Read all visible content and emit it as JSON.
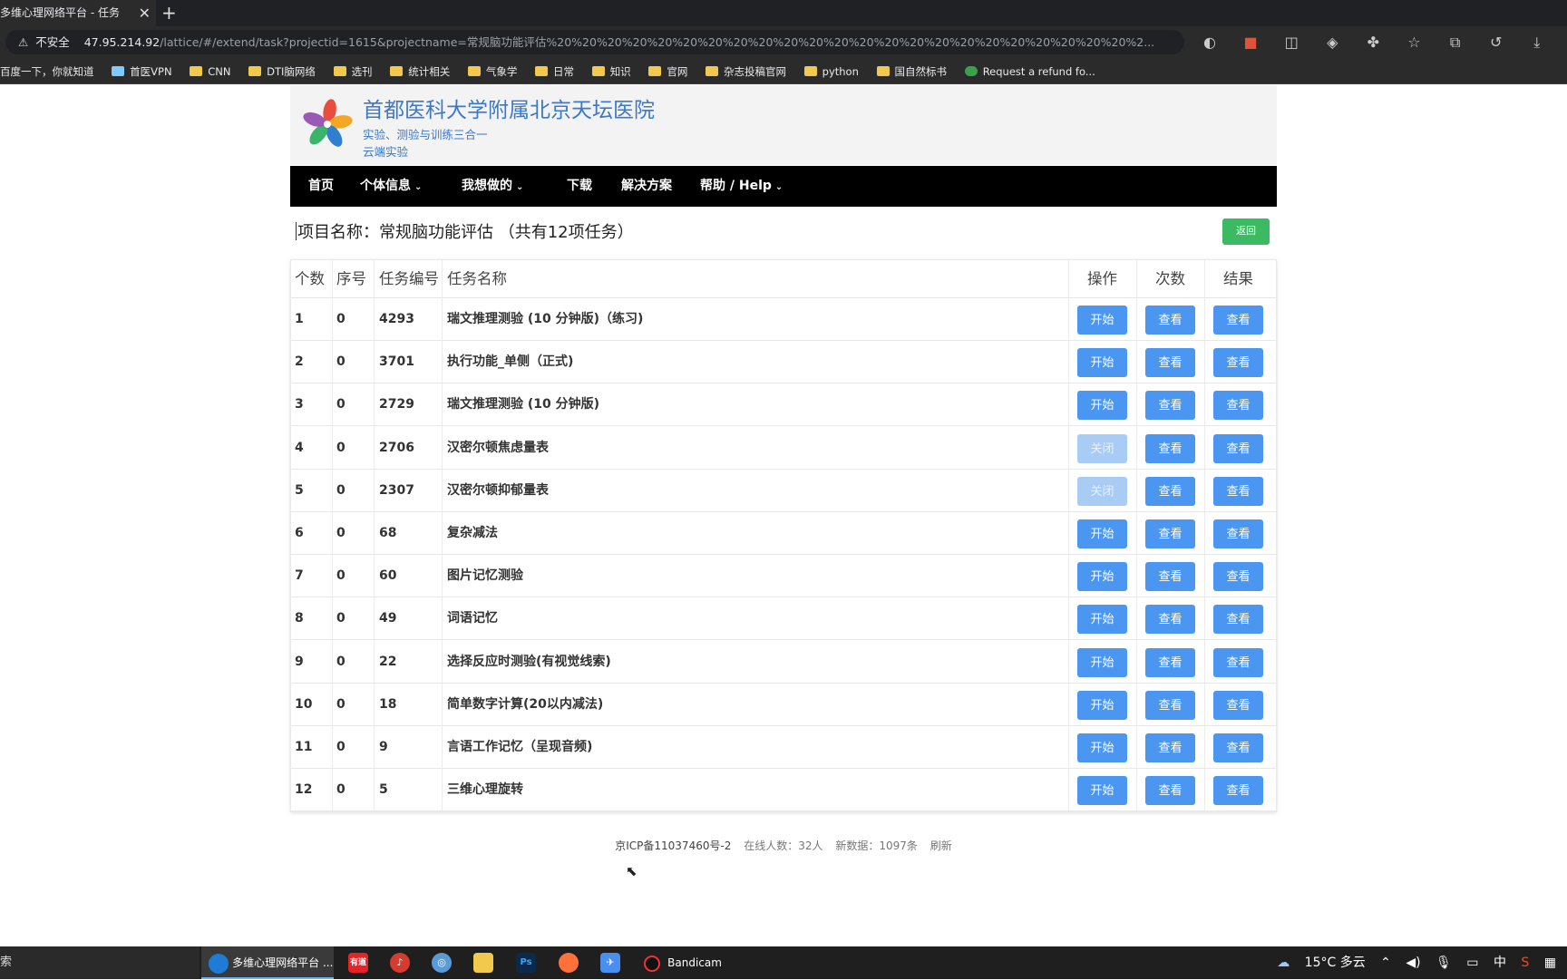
{
  "browser": {
    "tab_title": "多维心理网络平台 - 任务",
    "close_glyph": "✕",
    "new_tab_glyph": "+",
    "insecure_label": "不安全",
    "url_host": "47.95.214.92",
    "url_rest": "/lattice/#/extend/task?projectid=1615&projectname=常规脑功能评估%20%20%20%20%20%20%20%20%20%20%20%20%20%20%20%20%20%20%20%20%20%20%20%2...",
    "bookmarks": [
      "百度一下，你就知道",
      "首医VPN",
      "CNN",
      "DTI脑网络",
      "选刊",
      "统计相关",
      "气象学",
      "日常",
      "知识",
      "官网",
      "杂志投稿官网",
      "python",
      "国自然标书",
      "Request a refund fo..."
    ]
  },
  "header": {
    "title": "首都医科大学附属北京天坛医院",
    "subtitle1": "实验、测验与训练三合一",
    "subtitle2": "云端实验"
  },
  "nav": {
    "items": [
      "首页",
      "个体信息",
      "我想做的",
      "下载",
      "解决方案",
      "帮助 / Help"
    ]
  },
  "project": {
    "title": "项目名称：常规脑功能评估 （共有12项任务）",
    "back_label": "返回"
  },
  "table": {
    "headers": [
      "个数",
      "序号",
      "任务编号",
      "任务名称",
      "操作",
      "次数",
      "结果"
    ],
    "rows": [
      {
        "n": "1",
        "seq": "0",
        "id": "4293",
        "name": "瑞文推理测验 (10 分钟版)（练习)",
        "op": "开始",
        "op_disabled": false,
        "count": "查看",
        "result": "查看"
      },
      {
        "n": "2",
        "seq": "0",
        "id": "3701",
        "name": "执行功能_单侧（正式)",
        "op": "开始",
        "op_disabled": false,
        "count": "查看",
        "result": "查看"
      },
      {
        "n": "3",
        "seq": "0",
        "id": "2729",
        "name": "瑞文推理测验 (10 分钟版)",
        "op": "开始",
        "op_disabled": false,
        "count": "查看",
        "result": "查看"
      },
      {
        "n": "4",
        "seq": "0",
        "id": "2706",
        "name": "汉密尔顿焦虑量表",
        "op": "关闭",
        "op_disabled": true,
        "count": "查看",
        "result": "查看"
      },
      {
        "n": "5",
        "seq": "0",
        "id": "2307",
        "name": "汉密尔顿抑郁量表",
        "op": "关闭",
        "op_disabled": true,
        "count": "查看",
        "result": "查看"
      },
      {
        "n": "6",
        "seq": "0",
        "id": "68",
        "name": "复杂减法",
        "op": "开始",
        "op_disabled": false,
        "count": "查看",
        "result": "查看"
      },
      {
        "n": "7",
        "seq": "0",
        "id": "60",
        "name": "图片记忆测验",
        "op": "开始",
        "op_disabled": false,
        "count": "查看",
        "result": "查看"
      },
      {
        "n": "8",
        "seq": "0",
        "id": "49",
        "name": "词语记忆",
        "op": "开始",
        "op_disabled": false,
        "count": "查看",
        "result": "查看"
      },
      {
        "n": "9",
        "seq": "0",
        "id": "22",
        "name": "选择反应时测验(有视觉线索)",
        "op": "开始",
        "op_disabled": false,
        "count": "查看",
        "result": "查看"
      },
      {
        "n": "10",
        "seq": "0",
        "id": "18",
        "name": "简单数字计算(20以内减法)",
        "op": "开始",
        "op_disabled": false,
        "count": "查看",
        "result": "查看"
      },
      {
        "n": "11",
        "seq": "0",
        "id": "9",
        "name": "言语工作记忆（呈现音频)",
        "op": "开始",
        "op_disabled": false,
        "count": "查看",
        "result": "查看"
      },
      {
        "n": "12",
        "seq": "0",
        "id": "5",
        "name": "三维心理旋转",
        "op": "开始",
        "op_disabled": false,
        "count": "查看",
        "result": "查看"
      }
    ]
  },
  "footer": {
    "icp": "京ICP备11037460号-2",
    "online": "在线人数：32人",
    "new_data": "新数据：1097条",
    "refresh": "刷新"
  },
  "taskbar": {
    "search": "索",
    "active_app": "多维心理网络平台 ...",
    "bandicam": "Bandicam",
    "weather": "15°C 多云",
    "ime": "中"
  },
  "colors": {
    "primary_button": "#4a96f0",
    "disabled_button": "#a9ccf5",
    "back_button": "#3cba63",
    "header_title": "#3c78c8",
    "nav_bg": "#000000"
  }
}
